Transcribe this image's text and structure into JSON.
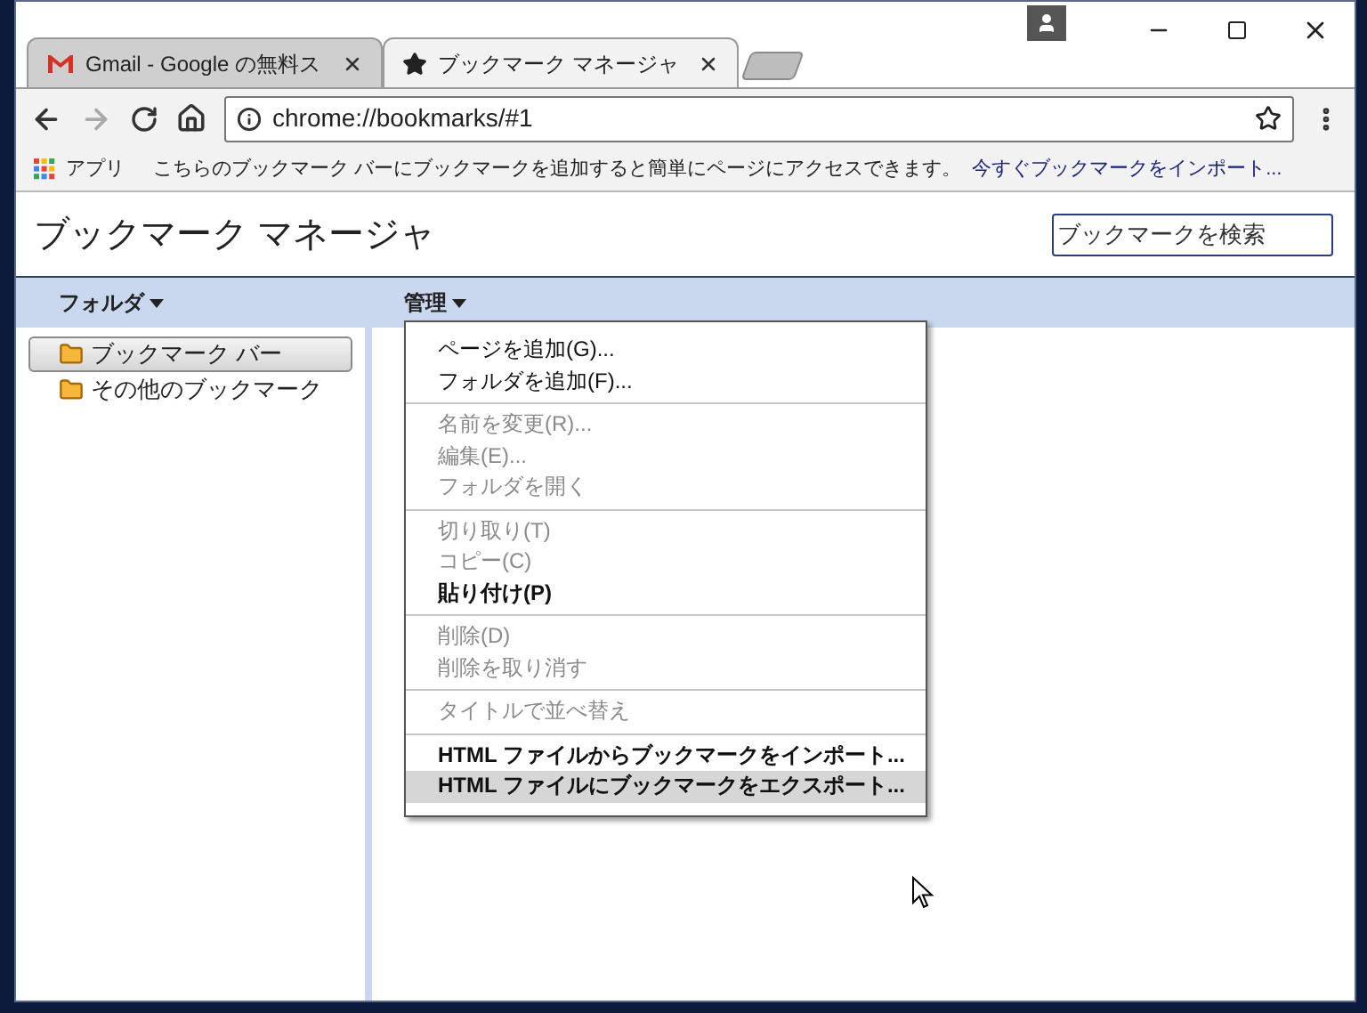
{
  "tabs": [
    {
      "title": "Gmail - Google の無料ス",
      "selected": false,
      "kind": "mail"
    },
    {
      "title": "ブックマーク マネージャ",
      "selected": true,
      "kind": "star"
    }
  ],
  "address_bar": {
    "url": "chrome://bookmarks/#1"
  },
  "bookmarks_bar": {
    "apps_label": "アプリ",
    "message": "こちらのブックマーク バーにブックマークを追加すると簡単にページにアクセスできます。",
    "import_link": "今すぐブックマークをインポート..."
  },
  "page": {
    "title": "ブックマーク マネージャ",
    "search": {
      "placeholder": "ブックマークを検索"
    }
  },
  "toolbar": {
    "folders_menu": "フォルダ",
    "organize_menu": "管理"
  },
  "folders": [
    {
      "name": "ブックマーク バー",
      "selected": true
    },
    {
      "name": "その他のブックマーク",
      "selected": false
    }
  ],
  "menu": {
    "groups": [
      [
        {
          "label": "ページを追加(G)...",
          "disabled": false,
          "bold": false,
          "selected": false
        },
        {
          "label": "フォルダを追加(F)...",
          "disabled": false,
          "bold": false,
          "selected": false
        }
      ],
      [
        {
          "label": "名前を変更(R)...",
          "disabled": true,
          "bold": false,
          "selected": false
        },
        {
          "label": "編集(E)...",
          "disabled": true,
          "bold": false,
          "selected": false
        },
        {
          "label": "フォルダを開く",
          "disabled": true,
          "bold": false,
          "selected": false
        }
      ],
      [
        {
          "label": "切り取り(T)",
          "disabled": true,
          "bold": false,
          "selected": false
        },
        {
          "label": "コピー(C)",
          "disabled": true,
          "bold": false,
          "selected": false
        },
        {
          "label": "貼り付け(P)",
          "disabled": false,
          "bold": true,
          "selected": false
        }
      ],
      [
        {
          "label": "削除(D)",
          "disabled": true,
          "bold": false,
          "selected": false
        },
        {
          "label": "削除を取り消す",
          "disabled": true,
          "bold": false,
          "selected": false
        }
      ],
      [
        {
          "label": "タイトルで並べ替え",
          "disabled": true,
          "bold": false,
          "selected": false
        }
      ],
      [
        {
          "label": "HTML ファイルからブックマークをインポート...",
          "disabled": false,
          "bold": true,
          "selected": false
        },
        {
          "label": "HTML ファイルにブックマークをエクスポート...",
          "disabled": false,
          "bold": true,
          "selected": true
        }
      ]
    ]
  }
}
